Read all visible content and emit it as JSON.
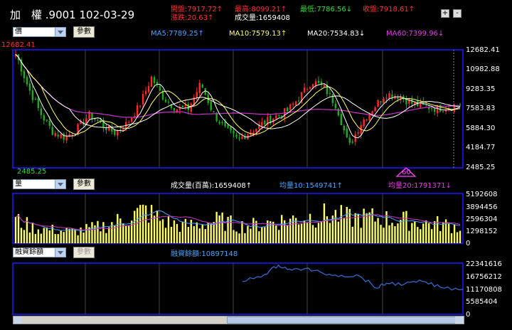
{
  "header": {
    "title": "加　權 .9001 102-03-29",
    "open": "開盤:7917.72↑",
    "high": "最高:8099.21↑",
    "low": "最低:7786.56↓",
    "close": "收盤:7918.61↑",
    "change": "漲跌:20.63↑",
    "volume": "成交量:1659408",
    "zoom_in": "+",
    "zoom_out": "-"
  },
  "price_panel": {
    "select_value": "價",
    "param_button": "參數",
    "ma5": "MA5:7789.25↑",
    "ma10": "MA10:7579.13↑",
    "ma20": "MA20:7534.83↓",
    "ma60": "MA60:7399.96↓",
    "max_label": "12682.41",
    "min_label": "2485.25",
    "marker_label": "60",
    "y_ticks": [
      "12682.41",
      "10982.88",
      "9283.35",
      "7583.83",
      "5884.30",
      "4184.77",
      "2485.25"
    ]
  },
  "volume_panel": {
    "select_value": "量",
    "param_button": "參數",
    "vol_label": "成交量(百萬):1659408↑",
    "avg10": "均量10:1549741↑",
    "avg20": "均量20:1791371↓",
    "y_ticks": [
      "5192608",
      "3894456",
      "2596304",
      "1298152",
      "0"
    ]
  },
  "margin_panel": {
    "select_value": "融資餘額",
    "param_button": "參數",
    "label": "融資餘額:10897148",
    "y_ticks": [
      "22341616",
      "16756212",
      "11170808",
      "5585404",
      "0"
    ]
  },
  "colors": {
    "frame": "#1a1aff",
    "candle_up": "#ff2a2a",
    "candle_down": "#22aa22",
    "ma5": "#ffffff",
    "ma10": "#ffff66",
    "ma20": "#ffffff",
    "ma60": "#cc33cc",
    "volume_bar": "#ffff66",
    "margin_line": "#3a6fd8"
  },
  "chart_data": [
    {
      "type": "line",
      "title": "",
      "ylim": [
        2485.25,
        12682.41
      ],
      "max_value": 12682.41,
      "min_value": 2485.25,
      "close_anchors": [
        12400,
        9500,
        7200,
        5600,
        5100,
        5900,
        7100,
        6200,
        5500,
        6300,
        7800,
        10300,
        8500,
        7600,
        7600,
        9800,
        7200,
        5800,
        4900,
        5600,
        6300,
        6900,
        7400,
        8600,
        10000,
        9400,
        7800,
        4300,
        6400,
        7700,
        8900,
        8700,
        8100,
        7800,
        7600,
        7700,
        7918.61
      ],
      "series": [
        {
          "name": "MA5",
          "color": "#ffffff"
        },
        {
          "name": "MA10",
          "color": "#ffff66"
        },
        {
          "name": "MA20",
          "color": "#ffffff"
        },
        {
          "name": "MA60",
          "color": "#cc33cc"
        }
      ]
    },
    {
      "type": "bar",
      "title": "",
      "ylim": [
        0,
        5192608
      ],
      "volume_anchors": [
        2400000,
        1600000,
        1400000,
        1200000,
        1500000,
        1900000,
        2700000,
        3400000,
        2300000,
        1800000,
        2000000,
        2400000,
        1800000,
        1900000,
        2300000,
        2500000,
        2800000,
        3000000,
        2600000,
        2700000,
        2500000,
        2400000,
        2100000,
        2000000,
        1659408
      ]
    },
    {
      "type": "line",
      "title": "",
      "ylim": [
        0,
        22341616
      ],
      "x_points": [
        0.51,
        0.56,
        0.59,
        0.62,
        0.65,
        0.69,
        0.73,
        0.77,
        0.81,
        0.83,
        0.87,
        0.91,
        0.95,
        1.0
      ],
      "values": [
        14300000,
        17500000,
        21500000,
        19300000,
        20000000,
        17800000,
        17000000,
        16800000,
        11400000,
        13600000,
        13200000,
        14400000,
        11800000,
        10897148
      ]
    }
  ]
}
